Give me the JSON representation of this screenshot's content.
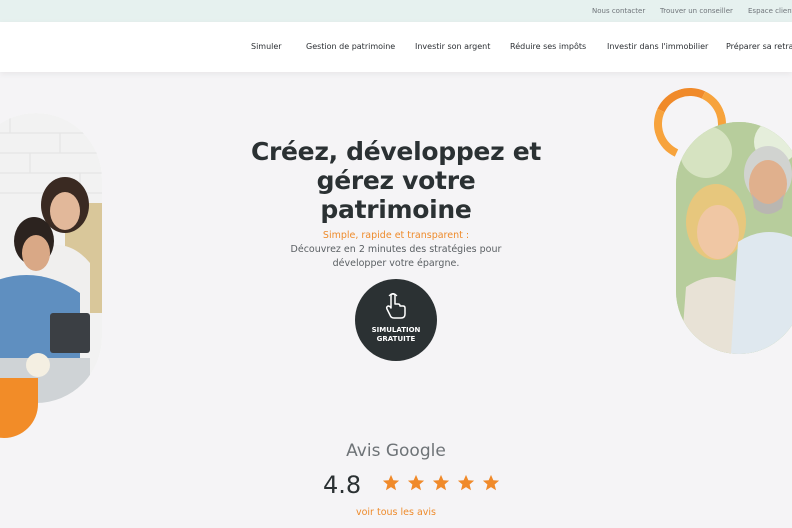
{
  "topbar": {
    "links": [
      "Nous contacter",
      "Trouver un conseiller",
      "Espace client"
    ]
  },
  "nav": {
    "items": [
      "Simuler",
      "Gestion de patrimoine",
      "Investir son argent",
      "Réduire ses impôts",
      "Investir dans l'immobilier",
      "Préparer sa retraite"
    ]
  },
  "hero": {
    "title": "Créez, développez et gérez votre patrimoine",
    "tagline": "Simple, rapide et transparent :",
    "description": "Découvrez en 2 minutes des stratégies pour développer votre épargne.",
    "cta_label": "SIMULATION GRATUITE",
    "cta_icon": "hand-pointer-icon"
  },
  "reviews": {
    "title": "Avis Google",
    "rating": "4.8",
    "stars": 5,
    "link_label": "voir tous les avis"
  },
  "colors": {
    "accent": "#ee8b2c",
    "dark": "#2b3133",
    "topbar_bg": "#e6f1ef",
    "page_bg": "#f5f4f6"
  }
}
